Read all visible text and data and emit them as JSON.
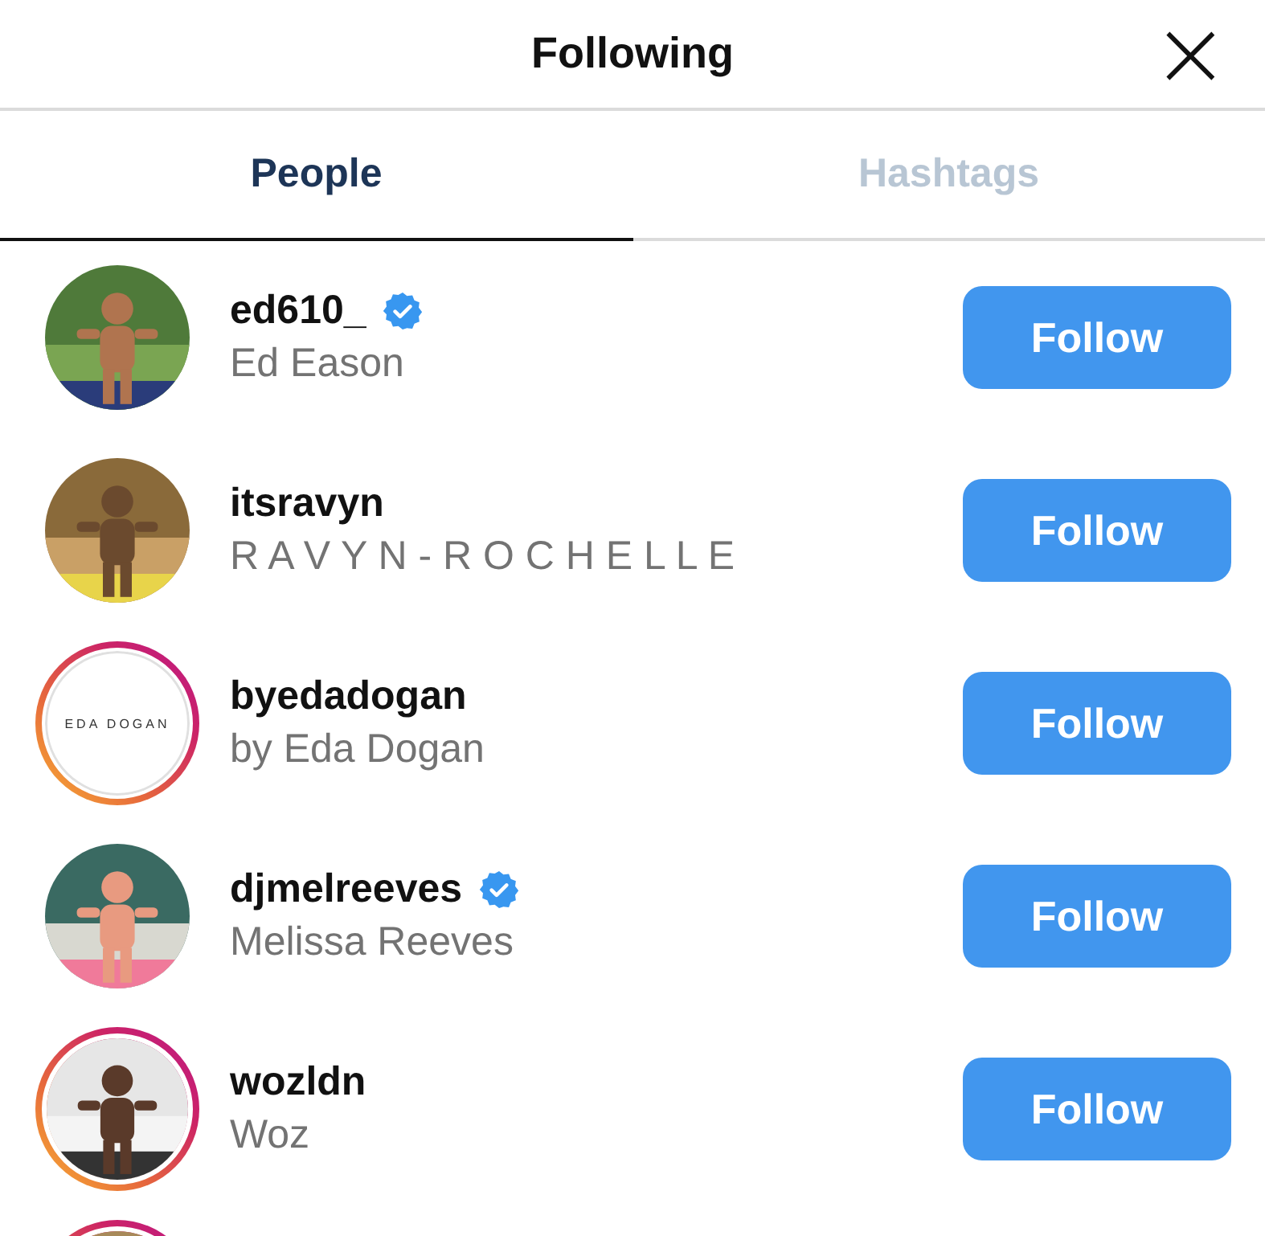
{
  "header": {
    "title": "Following",
    "close": "×"
  },
  "tabs": [
    {
      "label": "People",
      "selected": true
    },
    {
      "label": "Hashtags",
      "selected": false
    }
  ],
  "accounts": [
    {
      "username": "ed610_",
      "full_name": "Ed Eason",
      "verified": true,
      "story": false,
      "button": "Follow"
    },
    {
      "username": "itsravyn",
      "full_name": "R A V Y N - R O C H E L L E",
      "verified": false,
      "story": false,
      "button": "Follow"
    },
    {
      "username": "byedadogan",
      "full_name": "by Eda Dogan",
      "verified": false,
      "story": true,
      "avatar": {
        "kind": "logo",
        "text": "EDA DOGAN"
      },
      "button": "Follow"
    },
    {
      "username": "djmelreeves",
      "full_name": "Melissa Reeves",
      "verified": true,
      "story": false,
      "button": "Follow"
    },
    {
      "username": "wozldn",
      "full_name": "Woz",
      "verified": false,
      "story": true,
      "button": "Follow"
    },
    {
      "story": true
    }
  ]
}
